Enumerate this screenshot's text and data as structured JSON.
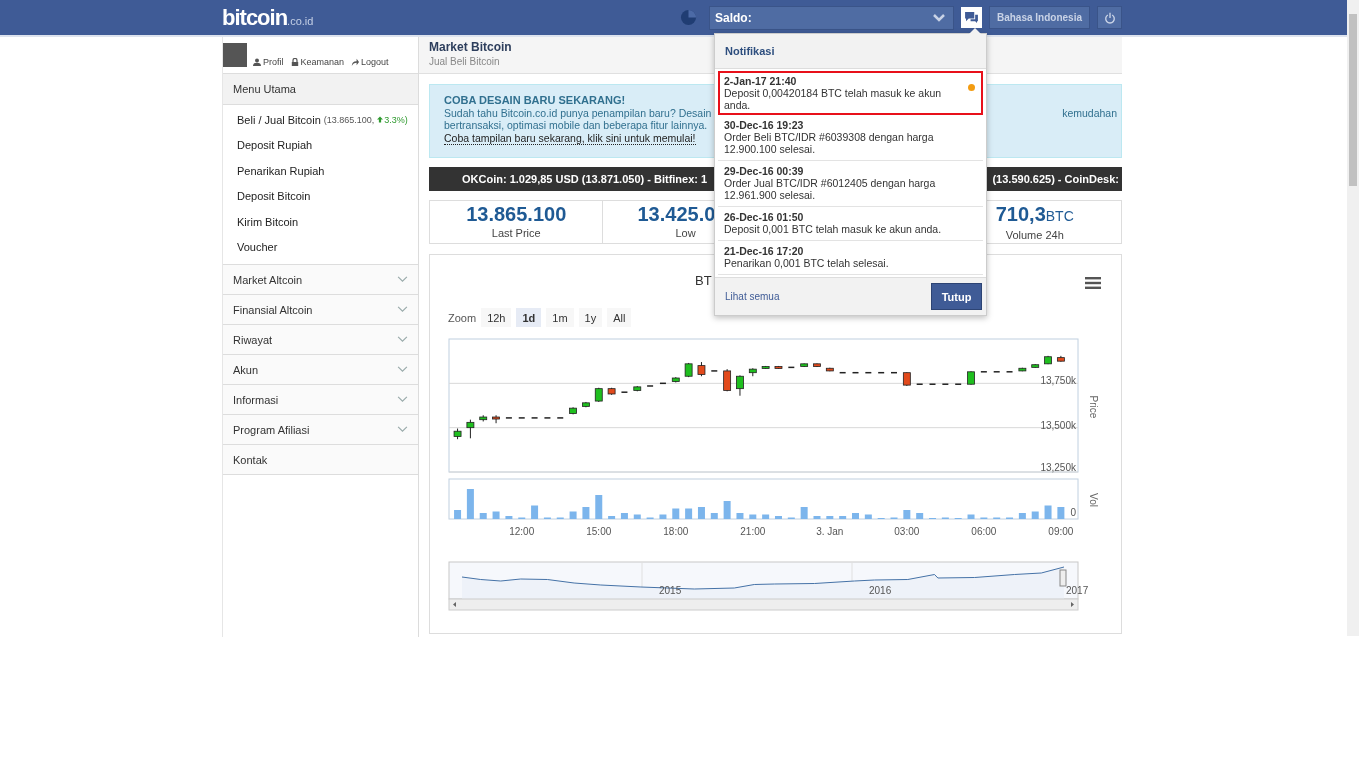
{
  "header": {
    "logo": "bitcoin",
    "logo_suffix": ".co.id",
    "saldo_label": "Saldo:",
    "language_button": "Bahasa Indonesia"
  },
  "user": {
    "links": [
      {
        "label": "Profil"
      },
      {
        "label": "Keamanan"
      },
      {
        "label": "Logout"
      }
    ]
  },
  "sidebar": {
    "heading": "Menu Utama",
    "items": [
      {
        "label": "Beli / Jual Bitcoin",
        "price": "(13.865.100,",
        "change": "3.3%)"
      },
      {
        "label": "Deposit Rupiah"
      },
      {
        "label": "Penarikan Rupiah"
      },
      {
        "label": "Deposit Bitcoin"
      },
      {
        "label": "Kirim Bitcoin"
      },
      {
        "label": "Voucher"
      }
    ],
    "sections": [
      {
        "label": "Market Altcoin",
        "kind": "collapsible",
        "expanded": false
      },
      {
        "label": "Finansial Altcoin",
        "kind": "collapsible",
        "expanded": false
      },
      {
        "label": "Riwayat",
        "kind": "collapsible",
        "expanded": false
      },
      {
        "label": "Akun",
        "kind": "collapsible",
        "expanded": false
      },
      {
        "label": "Informasi",
        "kind": "collapsible",
        "expanded": false
      },
      {
        "label": "Program Afiliasi",
        "kind": "collapsible",
        "expanded": false
      },
      {
        "label": "Kontak",
        "kind": "link"
      }
    ]
  },
  "page": {
    "title": "Market Bitcoin",
    "subtitle": "Jual Beli Bitcoin"
  },
  "promo": {
    "title": "COBA DESAIN BARU SEKARANG!",
    "line_1_left": "Sudah tahu Bitcoin.co.id punya penampilan baru? Desain",
    "line_1_right": "kemudahan",
    "line_2": "bertransaksi, optimasi mobile dan beberapa fitur lainnya.",
    "link": "Coba tampilan baru sekarang, klik sini untuk memulai!"
  },
  "ticker": {
    "left": "OKCoin: 1.029,85 USD (13.871.050) - Bitfinex: 1",
    "right": "(13.590.625) - CoinDesk:"
  },
  "stats": [
    {
      "value": "13.865.100",
      "label": "Last Price"
    },
    {
      "value": "13.425.0",
      "label": "Low"
    },
    {
      "value": "710,3",
      "unit": "BTC",
      "label": "Volume 24h"
    }
  ],
  "chart": {
    "title": "BT",
    "zoom_label": "Zoom",
    "zoom_options": [
      {
        "label": "12h",
        "selected": false
      },
      {
        "label": "1d",
        "selected": true
      },
      {
        "label": "1m",
        "selected": false
      },
      {
        "label": "1y",
        "selected": false
      },
      {
        "label": "All",
        "selected": false
      }
    ],
    "chart_data": {
      "type": "candlestick",
      "ylabel": "Price",
      "x": [
        "2017-01-02T09:30",
        "2017-01-02T10:00",
        "2017-01-02T10:30",
        "2017-01-02T11:00",
        "2017-01-02T11:30",
        "2017-01-02T12:00",
        "2017-01-02T12:30",
        "2017-01-02T13:00",
        "2017-01-02T13:30",
        "2017-01-02T14:00",
        "2017-01-02T14:30",
        "2017-01-02T15:00",
        "2017-01-02T15:30",
        "2017-01-02T16:00",
        "2017-01-02T16:30",
        "2017-01-02T17:00",
        "2017-01-02T17:30",
        "2017-01-02T18:00",
        "2017-01-02T18:30",
        "2017-01-02T19:00",
        "2017-01-02T19:30",
        "2017-01-02T20:00",
        "2017-01-02T20:30",
        "2017-01-02T21:00",
        "2017-01-02T21:30",
        "2017-01-02T22:00",
        "2017-01-02T22:30",
        "2017-01-02T23:00",
        "2017-01-02T23:30",
        "2017-01-03T00:00",
        "2017-01-03T00:30",
        "2017-01-03T01:00",
        "2017-01-03T01:30",
        "2017-01-03T02:00",
        "2017-01-03T02:30",
        "2017-01-03T03:00",
        "2017-01-03T03:30",
        "2017-01-03T04:00",
        "2017-01-03T04:30",
        "2017-01-03T05:00",
        "2017-01-03T05:30",
        "2017-01-03T06:00",
        "2017-01-03T06:30",
        "2017-01-03T07:00",
        "2017-01-03T07:30",
        "2017-01-03T08:00",
        "2017-01-03T08:30",
        "2017-01-03T09:00"
      ],
      "xticks": [
        {
          "value": "2017-01-02T12:00",
          "label": "12:00"
        },
        {
          "value": "2017-01-02T15:00",
          "label": "15:00"
        },
        {
          "value": "2017-01-02T18:00",
          "label": "18:00"
        },
        {
          "value": "2017-01-02T21:00",
          "label": "21:00"
        },
        {
          "value": "2017-01-03T00:00",
          "label": "3. Jan"
        },
        {
          "value": "2017-01-03T03:00",
          "label": "03:00"
        },
        {
          "value": "2017-01-03T06:00",
          "label": "06:00"
        },
        {
          "value": "2017-01-03T09:00",
          "label": "09:00"
        }
      ],
      "xlim": [
        "2017-01-02T09:10",
        "2017-01-03T09:40"
      ],
      "ylim": [
        13250,
        14000
      ],
      "ohlc": [
        [
          13450,
          13495,
          13435,
          13480
        ],
        [
          13500,
          13545,
          13440,
          13530
        ],
        [
          13545,
          13570,
          13535,
          13560
        ],
        [
          13560,
          13570,
          13525,
          13550
        ],
        [
          13555,
          13555,
          13555,
          13555
        ],
        [
          13555,
          13555,
          13555,
          13555
        ],
        [
          13555,
          13555,
          13555,
          13555
        ],
        [
          13555,
          13555,
          13555,
          13555
        ],
        [
          13555,
          13555,
          13555,
          13555
        ],
        [
          13580,
          13615,
          13575,
          13610
        ],
        [
          13620,
          13645,
          13615,
          13640
        ],
        [
          13650,
          13725,
          13645,
          13720
        ],
        [
          13720,
          13725,
          13685,
          13690
        ],
        [
          13700,
          13700,
          13700,
          13700
        ],
        [
          13710,
          13735,
          13705,
          13730
        ],
        [
          13735,
          13735,
          13735,
          13735
        ],
        [
          13750,
          13750,
          13750,
          13750
        ],
        [
          13760,
          13785,
          13755,
          13780
        ],
        [
          13790,
          13865,
          13785,
          13860
        ],
        [
          13850,
          13870,
          13790,
          13800
        ],
        [
          13820,
          13820,
          13820,
          13820
        ],
        [
          13820,
          13830,
          13705,
          13710
        ],
        [
          13720,
          13795,
          13680,
          13790
        ],
        [
          13810,
          13835,
          13790,
          13830
        ],
        [
          13835,
          13848,
          13832,
          13845
        ],
        [
          13845,
          13848,
          13832,
          13835
        ],
        [
          13840,
          13840,
          13840,
          13840
        ],
        [
          13845,
          13862,
          13842,
          13860
        ],
        [
          13860,
          13862,
          13842,
          13845
        ],
        [
          13835,
          13838,
          13818,
          13820
        ],
        [
          13810,
          13810,
          13810,
          13810
        ],
        [
          13810,
          13810,
          13810,
          13810
        ],
        [
          13810,
          13810,
          13810,
          13810
        ],
        [
          13810,
          13810,
          13810,
          13810
        ],
        [
          13810,
          13810,
          13810,
          13810
        ],
        [
          13810,
          13812,
          13735,
          13740
        ],
        [
          13745,
          13745,
          13745,
          13745
        ],
        [
          13745,
          13745,
          13745,
          13745
        ],
        [
          13745,
          13745,
          13745,
          13745
        ],
        [
          13745,
          13745,
          13745,
          13745
        ],
        [
          13745,
          13818,
          13742,
          13815
        ],
        [
          13815,
          13815,
          13815,
          13815
        ],
        [
          13815,
          13815,
          13815,
          13815
        ],
        [
          13815,
          13815,
          13815,
          13815
        ],
        [
          13820,
          13838,
          13818,
          13835
        ],
        [
          13840,
          13858,
          13838,
          13855
        ],
        [
          13860,
          13905,
          13858,
          13900
        ],
        [
          13895,
          13905,
          13872,
          13875
        ]
      ],
      "yticks": [
        {
          "value": 13750,
          "label": "13,750k"
        },
        {
          "value": 13500,
          "label": "13,500k"
        },
        {
          "value": 13250,
          "label": "13,250k"
        }
      ]
    },
    "volume_axis_label": "Vol",
    "volume_zero": "0",
    "navigator_years": [
      "2015",
      "2016",
      "2017"
    ]
  },
  "notifications": {
    "title": "Notifikasi",
    "items": [
      {
        "time": "2-Jan-17 21:40",
        "message": "Deposit 0,00420184 BTC telah masuk ke akun anda.",
        "unread": true,
        "highlighted": true
      },
      {
        "time": "30-Dec-16 19:23",
        "message": "Order Beli BTC/IDR #6039308 dengan harga 12.900.100 selesai.",
        "unread": false,
        "highlighted": false
      },
      {
        "time": "29-Dec-16 00:39",
        "message": "Order Jual BTC/IDR #6012405 dengan harga 12.961.900 selesai.",
        "unread": false,
        "highlighted": false
      },
      {
        "time": "26-Dec-16 01:50",
        "message": "Deposit 0,001 BTC telah masuk ke akun anda.",
        "unread": false,
        "highlighted": false
      },
      {
        "time": "21-Dec-16 17:20",
        "message": "Penarikan 0,001 BTC telah selesai.",
        "unread": false,
        "highlighted": false
      }
    ],
    "view_all": "Lihat semua",
    "close_button": "Tutup"
  }
}
